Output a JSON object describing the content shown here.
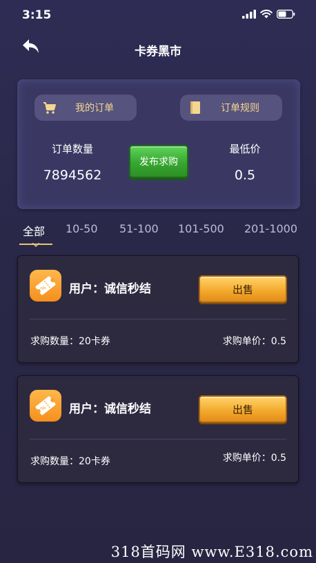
{
  "status": {
    "time": "3:15"
  },
  "nav": {
    "title": "卡券黑市"
  },
  "summary": {
    "my_orders_label": "我的订单",
    "order_rules_label": "订单规则",
    "order_count_label": "订单数量",
    "order_count_value": "7894562",
    "publish_button_label": "发布求购",
    "min_price_label": "最低价",
    "min_price_value": "0.5"
  },
  "tabs": [
    {
      "label": "全部",
      "active": true
    },
    {
      "label": "10-50",
      "active": false
    },
    {
      "label": "51-100",
      "active": false
    },
    {
      "label": "101-500",
      "active": false
    },
    {
      "label": "201-1000",
      "active": false
    }
  ],
  "listings": [
    {
      "user": "用户：诚信秒结",
      "sell_label": "出售",
      "quantity": "求购数量：20卡券",
      "unit_price": "求购单价：0.5"
    },
    {
      "user": "用户：诚信秒结",
      "sell_label": "出售",
      "quantity": "求购数量：20卡券",
      "unit_price": "求购单价：0.5"
    }
  ],
  "watermark": "318首码网 www.E318.com",
  "colors": {
    "background": "#2c2a4e",
    "panel": "#3a3863",
    "gold_text": "#f4d690",
    "publish_green": "#37a72f",
    "sell_orange": "#f3a72a",
    "app_icon_orange": "#f7a030"
  }
}
